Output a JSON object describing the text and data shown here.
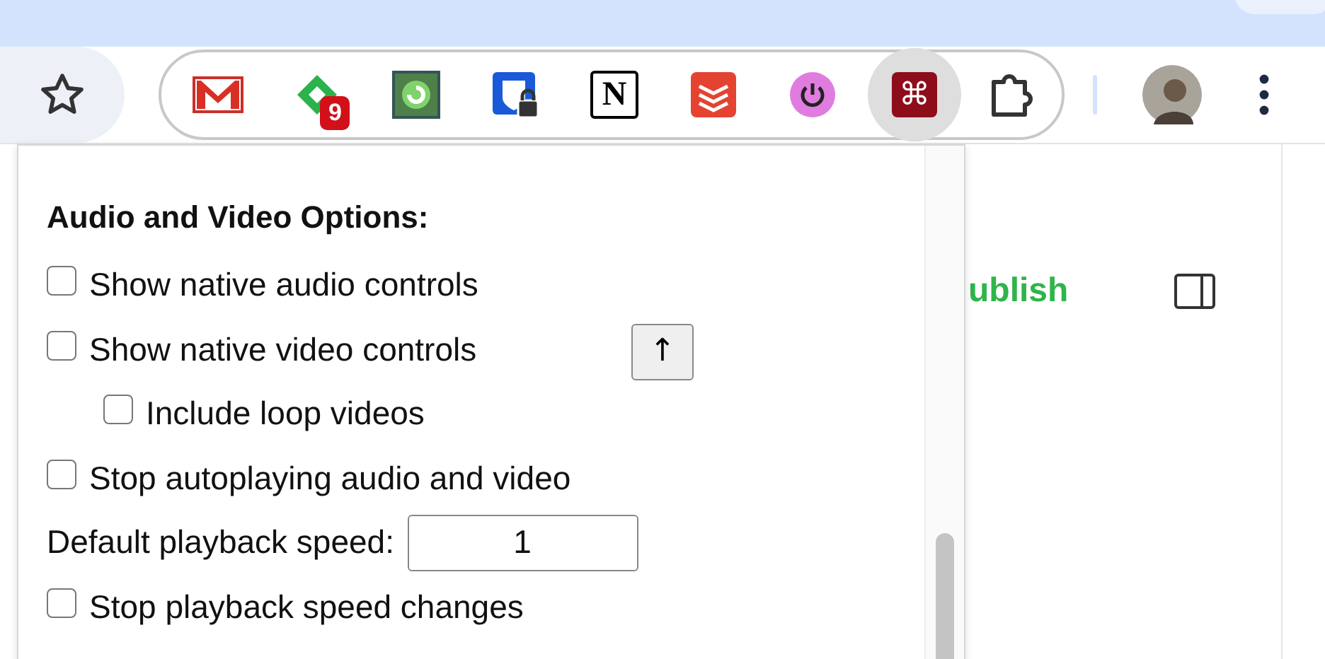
{
  "toolbar": {
    "bookmark_starred": false,
    "extensions": [
      {
        "kind": "mail",
        "selected": false
      },
      {
        "kind": "feed",
        "badge": "9",
        "selected": false
      },
      {
        "kind": "refresh",
        "selected": false
      },
      {
        "kind": "shield",
        "selected": false
      },
      {
        "kind": "letter",
        "glyph": "N",
        "selected": false
      },
      {
        "kind": "stack",
        "selected": false
      },
      {
        "kind": "power",
        "selected": false
      },
      {
        "kind": "command",
        "glyph": "⌘",
        "selected": true
      },
      {
        "kind": "puzzle",
        "selected": false
      }
    ]
  },
  "page": {
    "link": "ublish"
  },
  "popup": {
    "heading": "Audio and Video Options:",
    "scroll_button": "↑",
    "options": [
      {
        "kind": "checkbox",
        "label": "Show native audio controls",
        "checked": false
      },
      {
        "kind": "checkbox",
        "label": "Show native video controls",
        "checked": false,
        "children": [
          {
            "kind": "checkbox",
            "label": "Include loop videos",
            "checked": false
          }
        ]
      },
      {
        "kind": "checkbox",
        "label": "Stop autoplaying audio and video",
        "checked": false
      },
      {
        "kind": "number",
        "label": "Default playback speed:",
        "value": "1"
      },
      {
        "kind": "checkbox",
        "label": "Stop playback speed changes",
        "checked": false
      }
    ]
  }
}
